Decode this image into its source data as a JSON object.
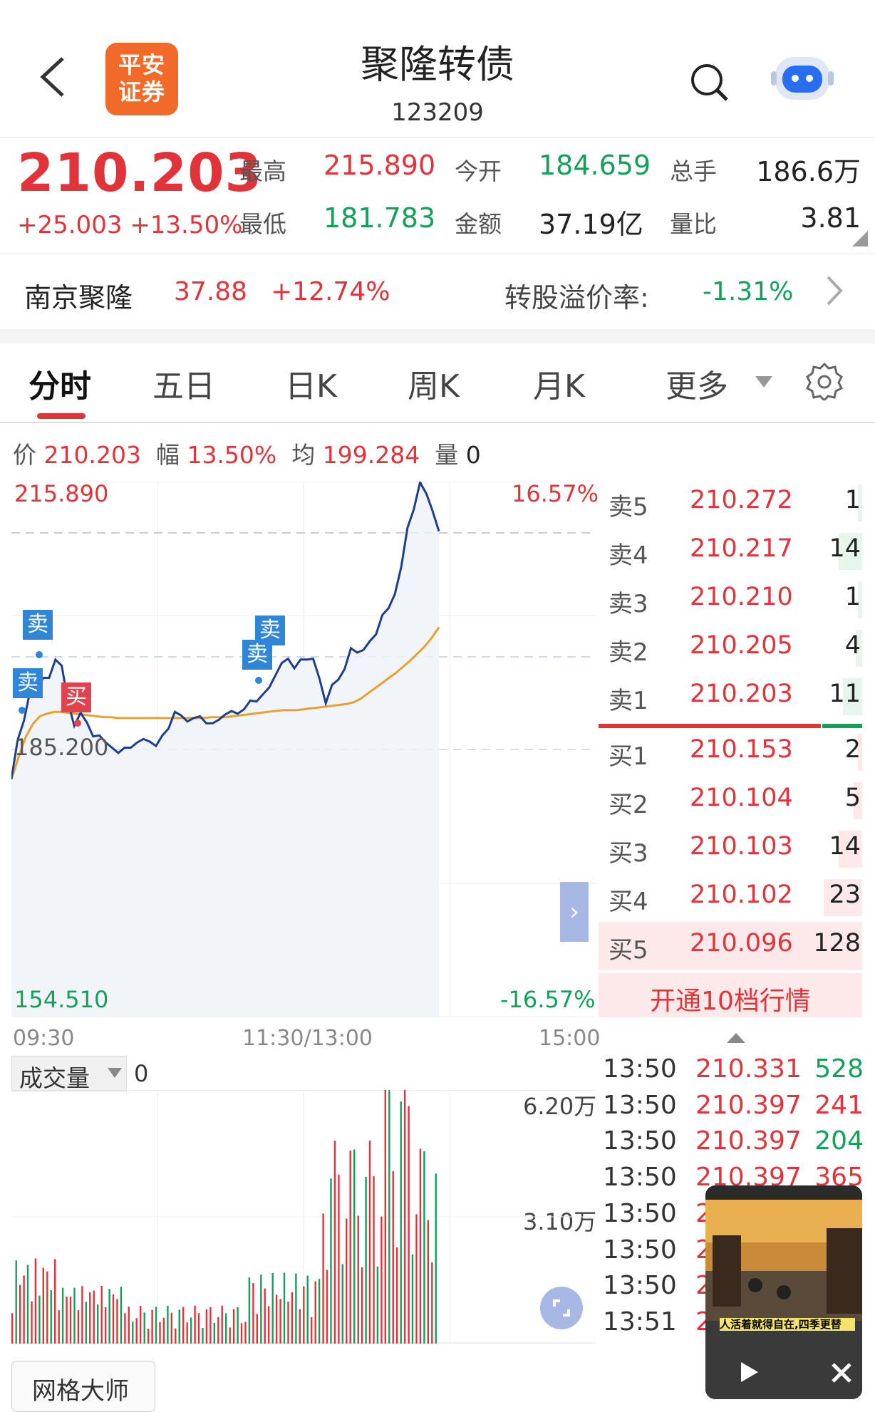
{
  "header": {
    "title": "聚隆转债",
    "code": "123209",
    "logo_text_line1": "平安",
    "logo_text_line2": "证券"
  },
  "quote": {
    "price": "210.203",
    "change": "+25.003",
    "change_pct": "+13.50%",
    "high_label": "最高",
    "high": "215.890",
    "low_label": "最低",
    "low": "181.783",
    "open_label": "今开",
    "open": "184.659",
    "amount_label": "金额",
    "amount": "37.19亿",
    "volume_label": "总手",
    "volume": "186.6万",
    "ratio_label": "量比",
    "ratio": "3.81"
  },
  "stock": {
    "name": "南京聚隆",
    "price": "37.88",
    "change_pct": "+12.74%",
    "premium_label": "转股溢价率:",
    "premium": "-1.31%"
  },
  "tabs": [
    "分时",
    "五日",
    "日K",
    "周K",
    "月K",
    "更多"
  ],
  "info": {
    "price_label": "价",
    "price": "210.203",
    "range_label": "幅",
    "range": "13.50%",
    "avg_label": "均",
    "avg": "199.284",
    "vol_label": "量",
    "vol": "0"
  },
  "chart_labels": {
    "top_price": "215.890",
    "top_pct": "16.57%",
    "mid_price": "185.200",
    "bottom_price": "154.510",
    "bottom_pct": "-16.57%",
    "t_start": "09:30",
    "t_mid": "11:30/13:00",
    "t_end": "15:00",
    "sell_tag": "卖",
    "buy_tag": "买",
    "vol_label": "成交量",
    "vol_value": "0",
    "vol_max": "6.20万",
    "vol_mid": "3.10万",
    "grid_button": "网格大师"
  },
  "chart_data": {
    "type": "line",
    "ylim": [
      154.51,
      215.89
    ],
    "prev_close": 185.2,
    "x_range": [
      "09:30",
      "15:00"
    ],
    "series": [
      {
        "values": [
          181.8,
          186.3,
          188.5,
          192,
          191.5,
          193.4,
          193.4,
          195.5,
          194.8,
          190.7,
          187.9,
          189.4,
          188.3,
          186.7,
          186.8,
          186,
          185.4,
          184.8,
          185.4,
          185.4,
          186,
          186.4,
          186.1,
          185.6,
          186.8,
          187.6,
          189.5,
          189.1,
          188.4,
          188.8,
          189,
          188.2,
          188.2,
          188.6,
          189.2,
          189.6,
          189.3,
          189.8,
          190.8,
          190.7,
          191.5,
          192.3,
          193.7,
          195.1,
          195.6,
          194.5,
          195.5,
          195.5,
          195.6,
          193.3,
          190.5,
          192.6,
          193.2,
          194.4,
          196.8,
          196.3,
          196.6,
          197.6,
          198.4,
          200.6,
          201.4,
          203,
          206.1,
          210.6,
          212.7,
          215.8,
          214.5,
          212.5,
          210.2
        ]
      },
      {
        "values": [
          181.8,
          184.3,
          186.6,
          188.1,
          189,
          189.3,
          189.5,
          189.5,
          189.4,
          189.3,
          189.2,
          189.1,
          189,
          188.9,
          188.9,
          188.8,
          188.8,
          188.8,
          188.8,
          188.8,
          188.8,
          188.8,
          188.8,
          188.8,
          188.8,
          188.8,
          188.8,
          188.8,
          188.9,
          188.9,
          188.9,
          189,
          189.1,
          189.2,
          189.3,
          189.4,
          189.5,
          189.6,
          189.7,
          189.7,
          189.7,
          189.8,
          189.9,
          190,
          190.1,
          190.2,
          190.3,
          190.4,
          190.6,
          191,
          191.6,
          192.2,
          192.8,
          193.4,
          194,
          194.7,
          195.4,
          196.2,
          197,
          198,
          199.2
        ]
      }
    ],
    "volume_ylim": [
      0,
      62000
    ]
  },
  "orderbook": {
    "asks": [
      {
        "label": "卖5",
        "price": "210.272",
        "vol": "1",
        "bar": 0.02
      },
      {
        "label": "卖4",
        "price": "210.217",
        "vol": "14",
        "bar": 0.11
      },
      {
        "label": "卖3",
        "price": "210.210",
        "vol": "1",
        "bar": 0.02
      },
      {
        "label": "卖2",
        "price": "210.205",
        "vol": "4",
        "bar": 0.03
      },
      {
        "label": "卖1",
        "price": "210.203",
        "vol": "11",
        "bar": 0.09
      }
    ],
    "bids": [
      {
        "label": "买1",
        "price": "210.153",
        "vol": "2",
        "bar": 0.02
      },
      {
        "label": "买2",
        "price": "210.104",
        "vol": "5",
        "bar": 0.04
      },
      {
        "label": "买3",
        "price": "210.103",
        "vol": "14",
        "bar": 0.11
      },
      {
        "label": "买4",
        "price": "210.102",
        "vol": "23",
        "bar": 0.18
      },
      {
        "label": "买5",
        "price": "210.096",
        "vol": "128",
        "bar": 1.0
      }
    ],
    "upgrade": "开通10档行情"
  },
  "trades": [
    {
      "time": "13:50",
      "price": "210.331",
      "vol": "528",
      "dir": "up"
    },
    {
      "time": "13:50",
      "price": "210.397",
      "vol": "241",
      "dir": "down"
    },
    {
      "time": "13:50",
      "price": "210.397",
      "vol": "204",
      "dir": "up"
    },
    {
      "time": "13:50",
      "price": "210.397",
      "vol": "365",
      "dir": "down"
    },
    {
      "time": "13:50",
      "price": "2",
      "vol": "",
      "dir": "down"
    },
    {
      "time": "13:50",
      "price": "2",
      "vol": "",
      "dir": "down"
    },
    {
      "time": "13:50",
      "price": "2",
      "vol": "",
      "dir": "down"
    },
    {
      "time": "13:51",
      "price": "2",
      "vol": "",
      "dir": "down"
    }
  ],
  "video": {
    "caption": "人活着就得自在,四季更替"
  },
  "colors": {
    "up": "#e0343a",
    "down": "#12a05a",
    "price_line": "#1e3f8c",
    "avg_line": "#e8a030"
  }
}
